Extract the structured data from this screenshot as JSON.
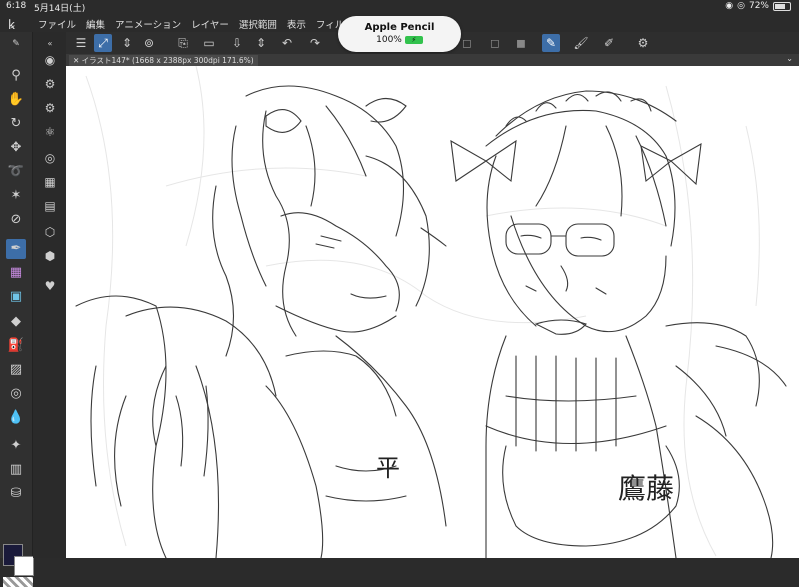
{
  "status": {
    "time": "6:18",
    "date": "5月14日(土)",
    "battery": "72%",
    "battery_fraction": 0.72
  },
  "menu": {
    "items": [
      "ファイル",
      "編集",
      "アニメーション",
      "レイヤー",
      "選択範囲",
      "表示",
      "フィルター"
    ]
  },
  "popup": {
    "title": "Apple Pencil",
    "level": "100%"
  },
  "document": {
    "tab_label": "イラスト147* (1668 x 2388px 300dpi 171.6%)"
  },
  "canvas_text": {
    "left_char": "平",
    "right_chars": "鷹藤"
  },
  "colors": {
    "main_color": "#1a1a3a",
    "sub_color": "#ffffff",
    "accent": "#3d6ea8"
  },
  "icons": {
    "toolbar": [
      "menu-icon",
      "transform-icon",
      "chevron-updown-icon",
      "view-icon",
      "new-file-icon",
      "open-folder-icon",
      "save-icon",
      "chevron-updown-icon",
      "undo-icon",
      "redo-icon",
      "pen-icon",
      "brush-icon",
      "pencil-icon",
      "settings-icon"
    ],
    "left_tools": [
      "zoom-icon",
      "hand-icon",
      "rotate-icon",
      "move-icon",
      "lasso-icon",
      "magic-wand-icon",
      "eyedropper-icon",
      "pen-tool-icon",
      "decoration-icon",
      "fill-icon",
      "eraser-icon",
      "bucket-icon",
      "gradient-icon",
      "figure-icon",
      "blend-icon",
      "sparkle-icon"
    ]
  }
}
